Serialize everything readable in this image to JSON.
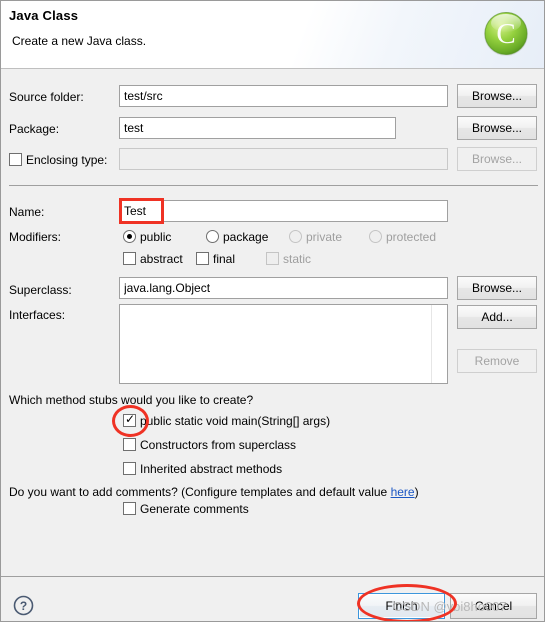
{
  "dialog": {
    "header": {
      "title": "Java Class",
      "subtitle": "Create a new Java class.",
      "icon": "java-class-green-c-icon"
    },
    "fields": {
      "source_folder": {
        "label": "Source folder:",
        "value": "test/src",
        "browse_label": "Browse..."
      },
      "package": {
        "label": "Package:",
        "value": "test",
        "browse_label": "Browse..."
      },
      "enclosing_type": {
        "label": "Enclosing type:",
        "value": "",
        "checked": false,
        "browse_label": "Browse..."
      },
      "name": {
        "label": "Name:",
        "value": "Test"
      },
      "superclass": {
        "label": "Superclass:",
        "value": "java.lang.Object",
        "browse_label": "Browse..."
      },
      "interfaces": {
        "label": "Interfaces:",
        "items": [],
        "add_label": "Add...",
        "remove_label": "Remove"
      }
    },
    "modifiers": {
      "label": "Modifiers:",
      "access": [
        {
          "label": "public",
          "selected": true,
          "enabled": true
        },
        {
          "label": "package",
          "selected": false,
          "enabled": true
        },
        {
          "label": "private",
          "selected": false,
          "enabled": false
        },
        {
          "label": "protected",
          "selected": false,
          "enabled": false
        }
      ],
      "flags": [
        {
          "label": "abstract",
          "checked": false,
          "enabled": true
        },
        {
          "label": "final",
          "checked": false,
          "enabled": true
        },
        {
          "label": "static",
          "checked": false,
          "enabled": false
        }
      ]
    },
    "stubs": {
      "question": "Which method stubs would you like to create?",
      "options": [
        {
          "label": "public static void main(String[] args)",
          "checked": true
        },
        {
          "label": "Constructors from superclass",
          "checked": false
        },
        {
          "label": "Inherited abstract methods",
          "checked": false
        }
      ]
    },
    "comments": {
      "question_before": "Do you want to add comments? (Configure templates and default value ",
      "link": "here",
      "question_after": ")",
      "generate": {
        "label": "Generate comments",
        "checked": false
      }
    },
    "footer": {
      "help_icon": "help-question-icon",
      "finish_label": "Finish",
      "cancel_label": "Cancel",
      "watermark": "CSDN @ybi8ho007"
    },
    "annotations": {
      "name_highlight": "red-rectangle-around-name-value",
      "main_checkbox_highlight": "red-ellipse-around-main-checkbox",
      "finish_highlight": "red-ellipse-around-finish-button"
    },
    "colors": {
      "accent_red": "#ef3224",
      "link_blue": "#1a56c4",
      "focus_blue": "#3c96dc",
      "icon_green": "#7ac943"
    }
  }
}
